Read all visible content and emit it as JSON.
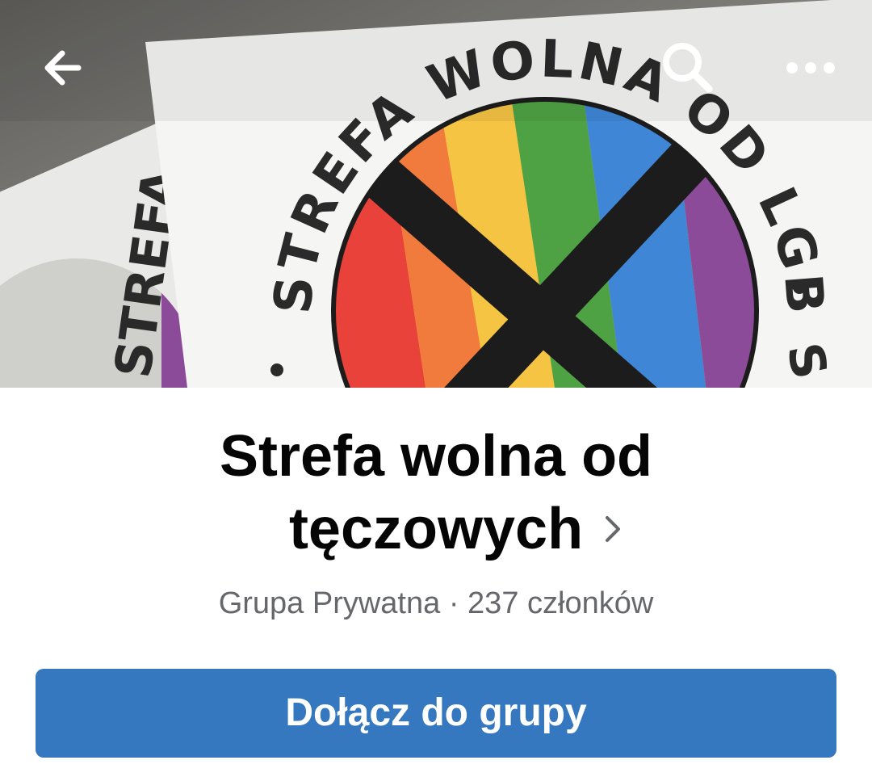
{
  "cover": {
    "sticker_text": "STREFA WOLNA OD LGBT",
    "sticker_colors": [
      "#e8423a",
      "#f07b3c",
      "#f6c443",
      "#4fa244",
      "#3f86d6",
      "#8c4b98"
    ]
  },
  "topbar": {
    "back_icon": "arrow-left-icon",
    "search_icon": "search-icon",
    "more_icon": "more-horizontal-icon"
  },
  "group": {
    "title_line1": "Strefa wolna od",
    "title_line2": "tęczowych",
    "title_chevron": "›",
    "privacy": "Grupa Prywatna",
    "separator": "·",
    "members": "237 członków"
  },
  "actions": {
    "join_label": "Dołącz do grupy"
  },
  "colors": {
    "primary": "#3578bf",
    "title_text": "#050505",
    "meta_text": "#65676b"
  }
}
